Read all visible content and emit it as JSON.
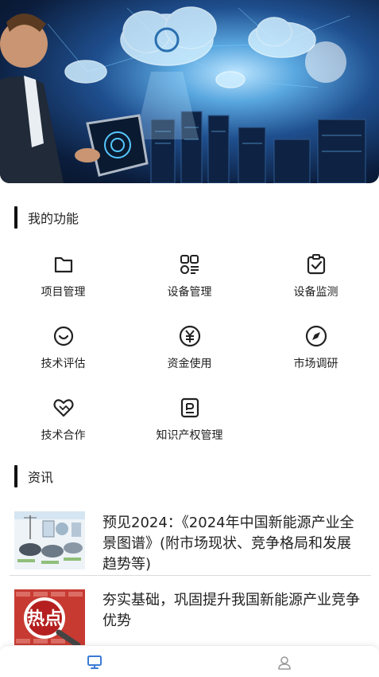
{
  "banner": {
    "image": "cloud-computing-data-center-illustration"
  },
  "functions": {
    "title": "我的功能",
    "items": [
      {
        "label": "项目管理",
        "icon": "folder-icon"
      },
      {
        "label": "设备管理",
        "icon": "device-grid-icon"
      },
      {
        "label": "设备监测",
        "icon": "clipboard-check-icon"
      },
      {
        "label": "技术评估",
        "icon": "smile-icon"
      },
      {
        "label": "资金使用",
        "icon": "yen-icon"
      },
      {
        "label": "市场调研",
        "icon": "compass-icon"
      },
      {
        "label": "技术合作",
        "icon": "handshake-heart-icon"
      },
      {
        "label": "知识产权管理",
        "icon": "document-icon"
      }
    ]
  },
  "news": {
    "title": "资讯",
    "items": [
      {
        "title": "预见2024：《2024年中国新能源产业全景图谱》(附市场现状、竞争格局和发展趋势等)",
        "thumb": "new-energy-vehicle-infographic"
      },
      {
        "title": "夯实基础，巩固提升我国新能源产业竞争优势",
        "thumb": "hot-topic-magnifier",
        "thumb_text": "热点"
      }
    ]
  },
  "tabbar": {
    "tabs": [
      {
        "icon": "monitor-icon",
        "active": true
      },
      {
        "icon": "user-icon",
        "active": false
      }
    ],
    "active_color": "#3a7bd5",
    "inactive_color": "#9a9a9a"
  }
}
